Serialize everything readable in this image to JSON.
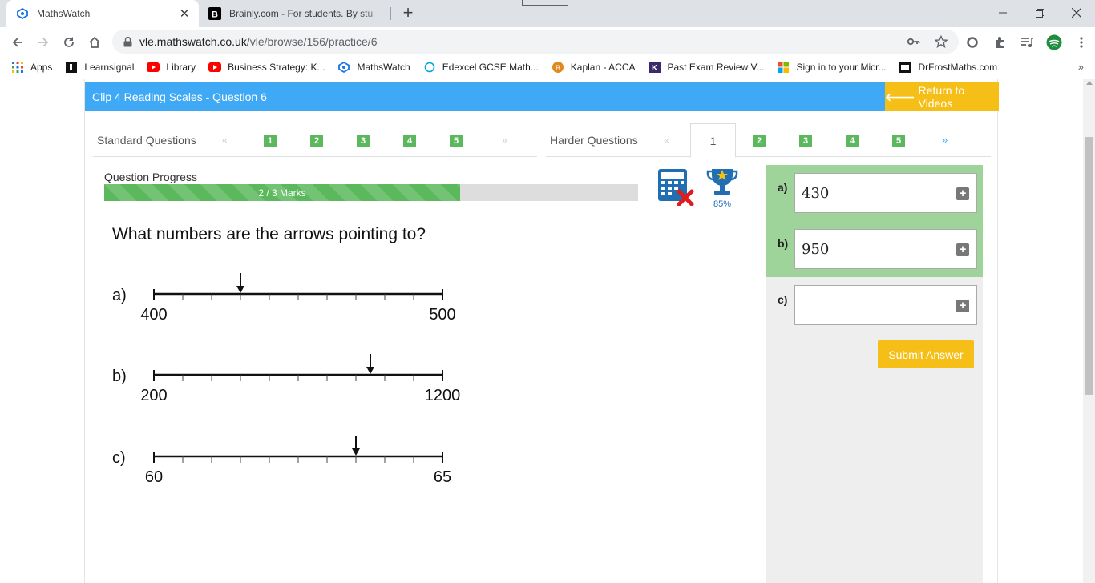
{
  "browser": {
    "tabs": [
      {
        "title": "MathsWatch",
        "active": true
      },
      {
        "title": "Brainly.com - For students. By stu",
        "active": false
      }
    ],
    "url_host": "vle.mathswatch.co.uk",
    "url_path": "/vle/browse/156/practice/6"
  },
  "bookmarks": [
    {
      "label": "Apps",
      "icon": "apps-grid-icon"
    },
    {
      "label": "Learnsignal",
      "icon": "learnsignal-icon"
    },
    {
      "label": "Library",
      "icon": "youtube-icon"
    },
    {
      "label": "Business Strategy: K...",
      "icon": "youtube-icon"
    },
    {
      "label": "MathsWatch",
      "icon": "mathswatch-icon"
    },
    {
      "label": "Edexcel GCSE Math...",
      "icon": "edexcel-icon"
    },
    {
      "label": "Kaplan - ACCA",
      "icon": "kaplan-icon"
    },
    {
      "label": "Past Exam Review V...",
      "icon": "kaplan-k-icon"
    },
    {
      "label": "Sign in to your Micr...",
      "icon": "microsoft-icon"
    },
    {
      "label": "DrFrostMaths.com",
      "icon": "dfm-icon"
    }
  ],
  "header": {
    "title": "Clip 4 Reading Scales - Question 6",
    "return_label": "Return to Videos"
  },
  "standard": {
    "label": "Standard Questions",
    "prev": "«",
    "next": "»",
    "numbers": [
      "1",
      "2",
      "3",
      "4",
      "5"
    ]
  },
  "harder": {
    "label": "Harder Questions",
    "prev": "«",
    "active": "1",
    "numbers": [
      "2",
      "3",
      "4",
      "5"
    ],
    "next": "»"
  },
  "progress": {
    "label": "Question Progress",
    "text": "2 / 3 Marks",
    "fraction": 0.667
  },
  "trophy_percent": "85%",
  "question": {
    "prompt": "What numbers are the arrows pointing to?",
    "parts": [
      {
        "letter": "a)",
        "min": "400",
        "max": "500",
        "arrow_fraction": 0.3
      },
      {
        "letter": "b)",
        "min": "200",
        "max": "1200",
        "arrow_fraction": 0.75
      },
      {
        "letter": "c)",
        "min": "60",
        "max": "65",
        "arrow_fraction": 0.7
      }
    ]
  },
  "answers": [
    {
      "letter": "a)",
      "value": "430",
      "status": "correct"
    },
    {
      "letter": "b)",
      "value": "950",
      "status": "correct"
    },
    {
      "letter": "c)",
      "value": "",
      "status": "pending"
    }
  ],
  "submit_label": "Submit Answer",
  "colors": {
    "header_blue": "#3fa9f5",
    "accent_yellow": "#f5bf17",
    "success_green": "#5cb85c",
    "correct_bg": "#9ed49a"
  }
}
